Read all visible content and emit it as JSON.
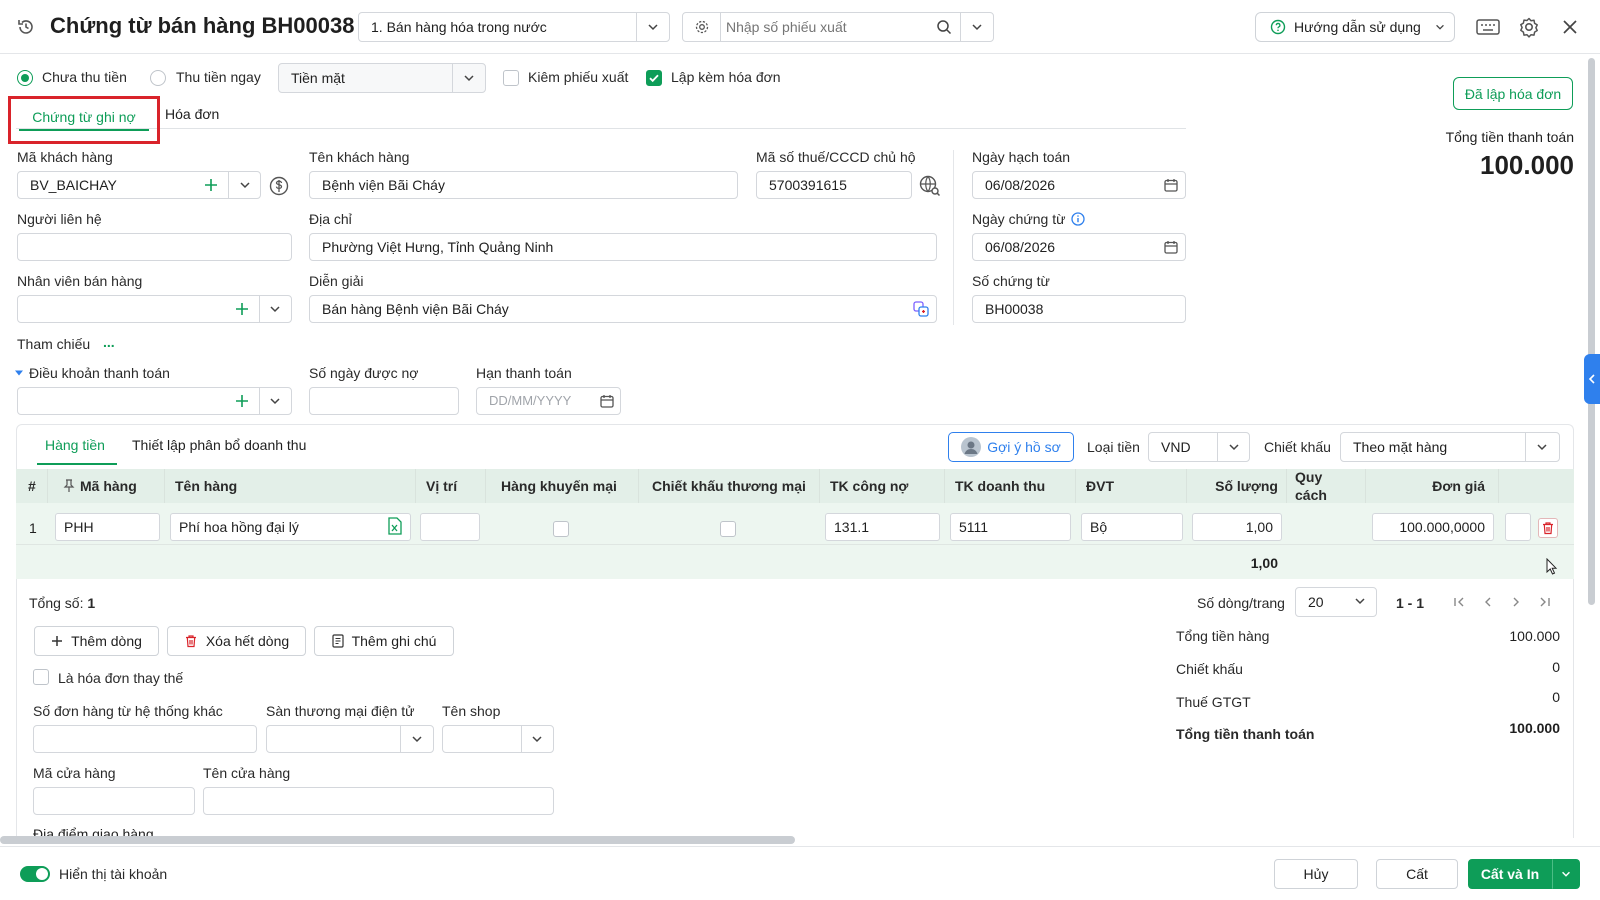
{
  "header": {
    "title": "Chứng từ bán hàng BH00038",
    "sale_type": "1. Bán hàng hóa trong nước",
    "search_placeholder": "Nhập số phiếu xuất",
    "help_label": "Hướng dẫn sử dụng"
  },
  "options": {
    "unpaid_label": "Chưa thu tiền",
    "paid_now_label": "Thu tiền ngay",
    "payment_method": "Tiền mặt",
    "check_receipt_label": "Kiêm phiếu xuất",
    "with_invoice_label": "Lập kèm hóa đơn",
    "invoiced_button": "Đã lập hóa đơn"
  },
  "tabs": [
    "Chứng từ ghi nợ",
    "Hóa đơn"
  ],
  "total_box": {
    "label": "Tổng tiền thanh toán",
    "value": "100.000"
  },
  "form": {
    "customer_code_label": "Mã khách hàng",
    "customer_code": "BV_BAICHAY",
    "customer_name_label": "Tên khách hàng",
    "customer_name": "Bệnh viện Bãi Cháy",
    "tax_code_label": "Mã số thuế/CCCD chủ hộ",
    "tax_code": "5700391615",
    "posting_date_label": "Ngày hạch toán",
    "posting_date": "06/08/2026",
    "contact_label": "Người liên hệ",
    "contact": "",
    "address_label": "Địa chỉ",
    "address": "Phường Việt Hưng, Tỉnh Quảng Ninh",
    "voucher_date_label": "Ngày chứng từ",
    "voucher_date": "06/08/2026",
    "salesperson_label": "Nhân viên bán hàng",
    "salesperson": "",
    "description_label": "Diễn giải",
    "description": "Bán hàng Bệnh viện Bãi Cháy",
    "voucher_no_label": "Số chứng từ",
    "voucher_no": "BH00038",
    "reference_label": "Tham chiếu",
    "reference_more": "...",
    "payment_terms_label": "Điều khoản thanh toán",
    "credit_days_label": "Số ngày được nợ",
    "due_date_label": "Hạn thanh toán",
    "due_date_placeholder": "DD/MM/YYYY"
  },
  "detail_tabs": [
    "Hàng tiền",
    "Thiết lập phân bổ doanh thu"
  ],
  "detail_toolbar": {
    "suggest_label": "Gợi ý hồ sơ",
    "currency_label": "Loại tiền",
    "currency": "VND",
    "discount_label": "Chiết khấu",
    "discount_mode": "Theo mặt hàng"
  },
  "table": {
    "columns": [
      "#",
      "Mã hàng",
      "Tên hàng",
      "Vị trí",
      "Hàng khuyến mại",
      "Chiết khấu thương mại",
      "TK công nợ",
      "TK doanh thu",
      "ĐVT",
      "Số lượng",
      "Quy cách",
      "Đơn giá"
    ],
    "rows": [
      {
        "no": "1",
        "code": "PHH",
        "name": "Phí hoa hồng đại lý",
        "location": "",
        "ar_account": "131.1",
        "revenue_account": "5111",
        "unit": "Bộ",
        "quantity": "1,00",
        "spec": "",
        "unit_price": "100.000,0000"
      }
    ],
    "sum_quantity": "1,00"
  },
  "footer_list": {
    "total_count_label": "Tổng số:",
    "total_count": "1",
    "rows_per_page_label": "Số dòng/trang",
    "rows_per_page": "20",
    "page_range": "1 - 1",
    "add_row": "Thêm dòng",
    "delete_all": "Xóa hết dòng",
    "add_note": "Thêm ghi chú",
    "replacement_invoice": "Là hóa đơn thay thế"
  },
  "extra": {
    "other_order_label": "Số đơn hàng từ hệ thống khác",
    "ecommerce_label": "Sàn thương mại điện tử",
    "shop_label": "Tên shop",
    "store_code_label": "Mã cửa hàng",
    "store_name_label": "Tên cửa hàng",
    "delivery_label": "Địa điểm giao hàng"
  },
  "summary": {
    "goods_total_label": "Tổng tiền hàng",
    "goods_total": "100.000",
    "discount_label": "Chiết khấu",
    "discount": "0",
    "vat_label": "Thuế GTGT",
    "vat": "0",
    "payment_total_label": "Tổng tiền thanh toán",
    "payment_total": "100.000"
  },
  "bottom_bar": {
    "show_account_label": "Hiển thị tài khoản",
    "cancel": "Hủy",
    "save": "Cất",
    "save_print": "Cất và In"
  },
  "colors": {
    "accent": "#0e9d58",
    "highlight_border": "#d9232a",
    "table_header_bg": "#e3efe8"
  }
}
